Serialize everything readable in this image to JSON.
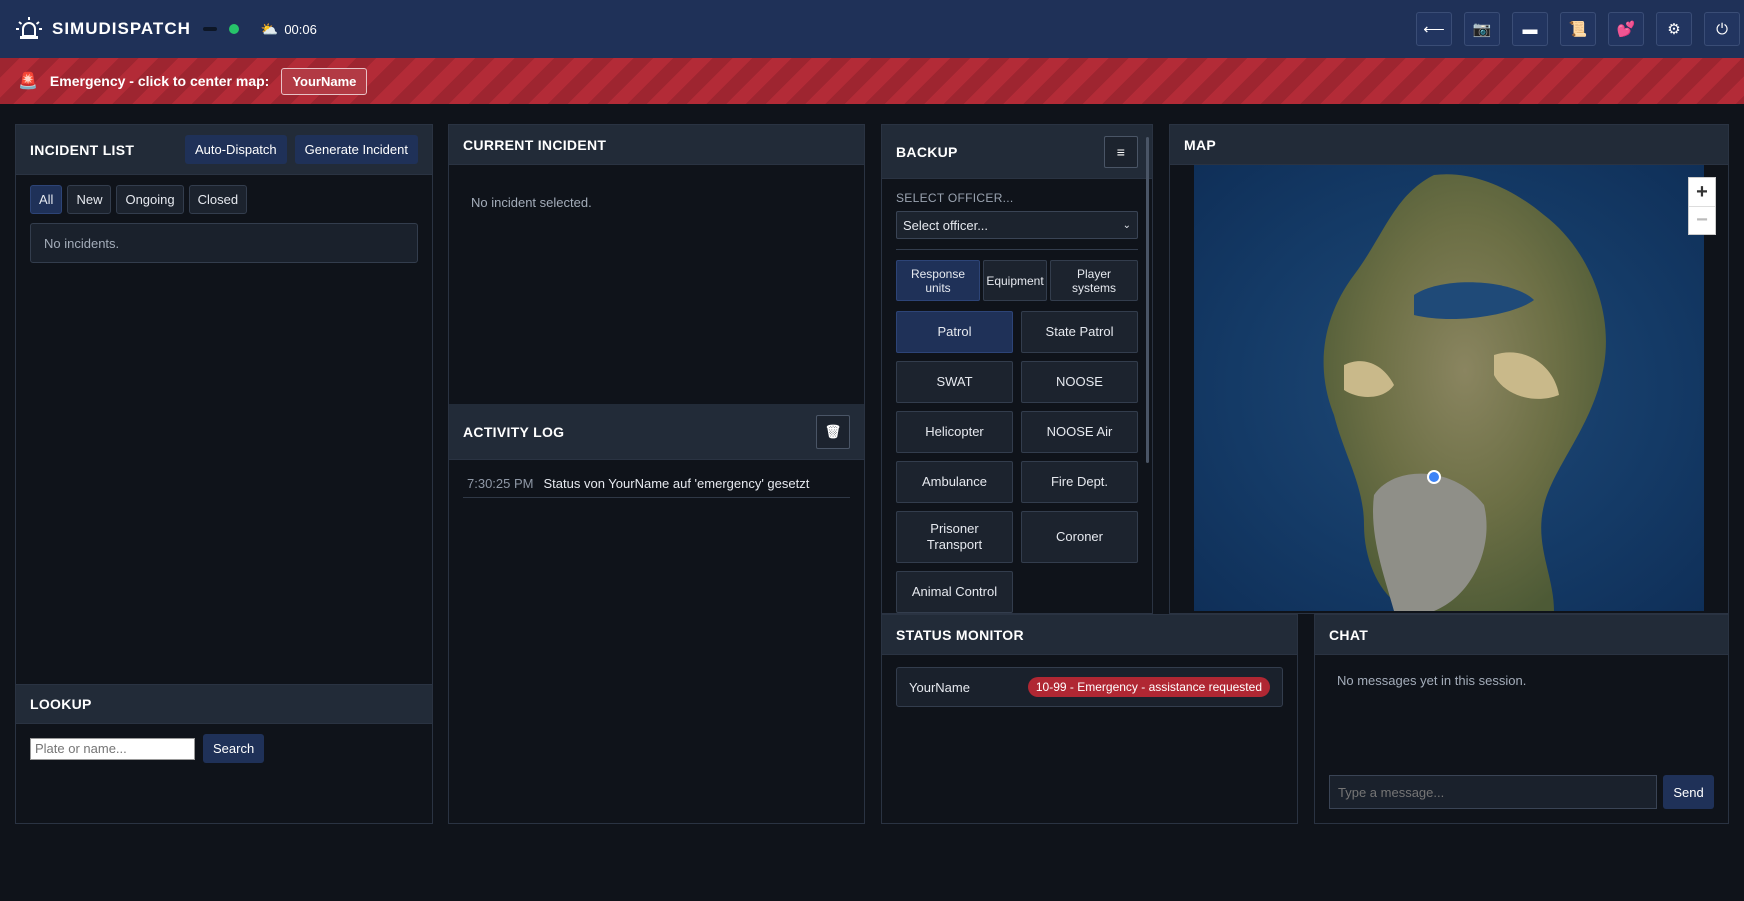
{
  "header": {
    "app_name": "SIMUDISPATCH",
    "clock": "00:06",
    "tools": [
      "arrow-left-icon",
      "camera-icon",
      "minus-bar-icon",
      "scroll-icon",
      "heart-icon",
      "gear-icon",
      "power-icon"
    ]
  },
  "banner": {
    "text": "Emergency - click to center map:",
    "name": "YourName"
  },
  "incident_list": {
    "title": "INCIDENT LIST",
    "auto_dispatch": "Auto-Dispatch",
    "generate": "Generate Incident",
    "filters": [
      "All",
      "New",
      "Ongoing",
      "Closed"
    ],
    "empty": "No incidents."
  },
  "lookup": {
    "title": "LOOKUP",
    "placeholder": "Plate or name...",
    "button": "Search"
  },
  "current_incident": {
    "title": "CURRENT INCIDENT",
    "empty": "No incident selected."
  },
  "activity_log": {
    "title": "ACTIVITY LOG",
    "entries": [
      {
        "time": "7:30:25 PM",
        "text": "Status von YourName auf 'emergency' gesetzt"
      }
    ]
  },
  "backup": {
    "title": "BACKUP",
    "select_label": "SELECT OFFICER...",
    "select_value": "Select officer...",
    "tabs": [
      "Response units",
      "Equipment",
      "Player systems"
    ],
    "units": [
      "Patrol",
      "State Patrol",
      "SWAT",
      "NOOSE",
      "Helicopter",
      "NOOSE Air",
      "Ambulance",
      "Fire Dept.",
      "Prisoner Transport",
      "Coroner",
      "Animal Control"
    ]
  },
  "map": {
    "title": "MAP",
    "zoom_in": "+",
    "zoom_out": "−"
  },
  "status_monitor": {
    "title": "STATUS MONITOR",
    "rows": [
      {
        "name": "YourName",
        "status": "10-99 - Emergency - assistance requested"
      }
    ]
  },
  "chat": {
    "title": "CHAT",
    "empty": "No messages yet in this session.",
    "placeholder": "Type a message...",
    "send": "Send"
  },
  "colors": {
    "header": "#1f3158",
    "accent": "#1f3158",
    "emergency": "#b02733",
    "online": "#27c46a"
  }
}
